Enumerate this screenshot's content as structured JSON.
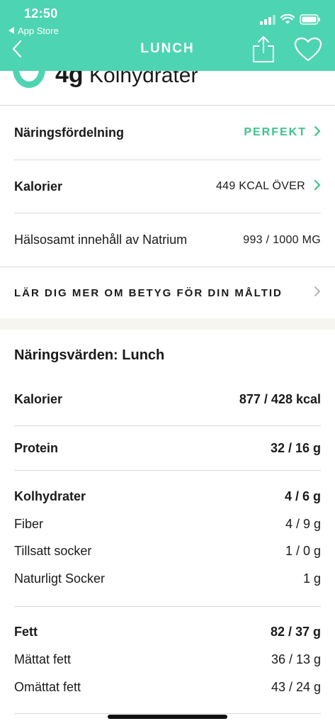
{
  "status_bar": {
    "time": "12:50",
    "back_app": "App Store"
  },
  "nav": {
    "title": "LUNCH"
  },
  "summary_peek": {
    "amount": "4g",
    "label": "Kolhydrater"
  },
  "rating_rows": [
    {
      "label": "Näringsfördelning",
      "value": "PERFEKT"
    },
    {
      "label": "Kalorier",
      "value": "449 KCAL ÖVER"
    },
    {
      "label": "Hälsosamt innehåll av Natrium",
      "value": "993 / 1000 MG"
    }
  ],
  "learn_more": "LÄR DIG MER OM BETYG FÖR DIN MÅLTID",
  "nutrition": {
    "title": "Näringsvärden: Lunch",
    "calories": {
      "label": "Kalorier",
      "value": "877 / 428 kcal"
    },
    "protein": {
      "label": "Protein",
      "value": "32 / 16 g"
    },
    "carbs": {
      "label": "Kolhydrater",
      "value": "4 / 6 g"
    },
    "fiber": {
      "label": "Fiber",
      "value": "4 / 9 g"
    },
    "added_sugar": {
      "label": "Tillsatt socker",
      "value": "1 / 0 g"
    },
    "natural_sugar": {
      "label": "Naturligt Socker",
      "value": "1 g"
    },
    "fat": {
      "label": "Fett",
      "value": "82 / 37 g"
    },
    "sat_fat": {
      "label": "Mättat fett",
      "value": "36 / 13 g"
    },
    "unsat_fat": {
      "label": "Omättat fett",
      "value": "43 / 24 g"
    }
  },
  "colors": {
    "brand": "#4dd4b3",
    "positive": "#3cc48b",
    "divider": "#d9d9d9"
  }
}
